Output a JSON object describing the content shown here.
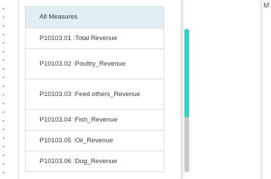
{
  "dropdown": {
    "header_label": "All Measures",
    "items": [
      {
        "label": "P10103.01 :Total Revenue"
      },
      {
        "label": "P10103.02 :Poultry_Revenue"
      },
      {
        "label": "P10103.03 :Feed others_Revenue"
      },
      {
        "label": "P10103.04 :Fish_Revenue"
      },
      {
        "label": "P10103.05 :Oil_Revenue"
      },
      {
        "label": "P10103.06 :Dog_Revenue"
      }
    ],
    "scroll_position": 0.0,
    "scroll_visible_fraction": 0.62,
    "colors": {
      "header_bg": "#e1eef6",
      "scroll_thumb": "#35d2c2",
      "scroll_track": "#c9c9c9"
    }
  },
  "right_panel": {
    "label": "M"
  }
}
